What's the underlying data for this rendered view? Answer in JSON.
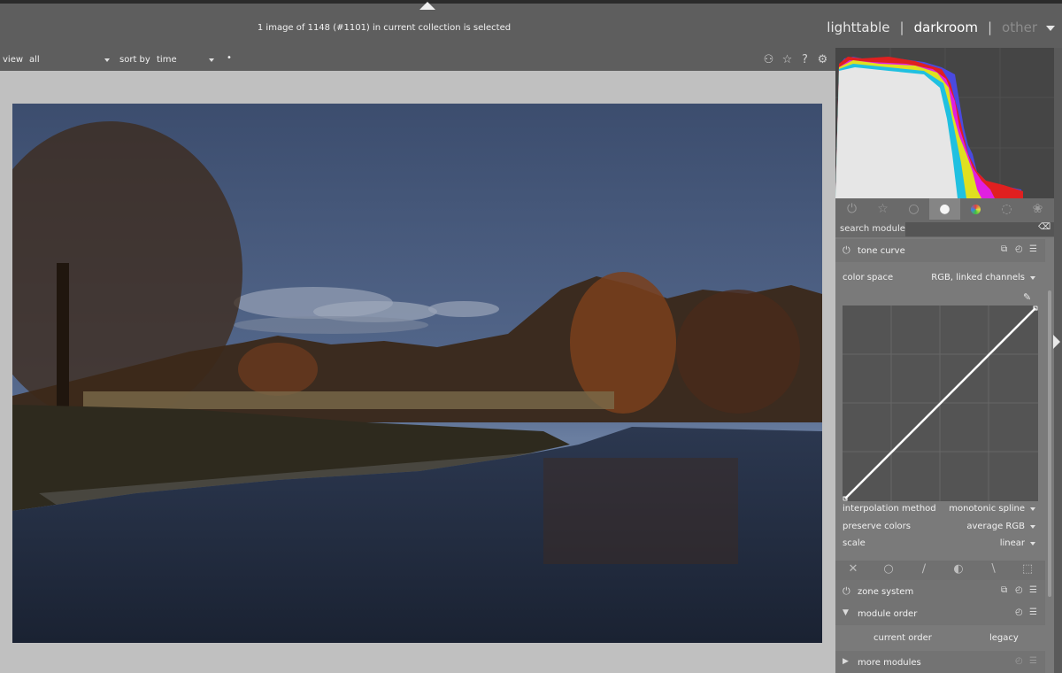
{
  "header": {
    "collection_info": "1 image of 1148 (#1101) in current collection is selected",
    "views": {
      "lighttable": "lighttable",
      "separator": "|",
      "darkroom": "darkroom",
      "other": "other"
    }
  },
  "filterbar": {
    "view_label": "view",
    "view_value": "all",
    "sort_label": "sort by",
    "sort_value": "time",
    "sort_dir": "•",
    "icons": [
      "color-labels-icon",
      "star-icon",
      "help-icon",
      "gear-icon"
    ]
  },
  "module_groups": {
    "icons": [
      "power-icon",
      "star-icon",
      "circle-icon",
      "tone-icon",
      "color-icon",
      "correct-icon",
      "effect-icon"
    ],
    "active_index": 3
  },
  "search": {
    "label": "search module",
    "value": ""
  },
  "tone_curve": {
    "name": "tone curve",
    "color_space_label": "color space",
    "color_space_value": "RGB, linked channels",
    "interpolation_label": "interpolation method",
    "interpolation_value": "monotonic spline",
    "preserve_label": "preserve colors",
    "preserve_value": "average RGB",
    "scale_label": "scale",
    "scale_value": "linear"
  },
  "zone_system": {
    "name": "zone system"
  },
  "module_order": {
    "name": "module order",
    "current": "current order",
    "legacy": "legacy"
  },
  "more_modules": {
    "name": "more modules"
  },
  "colors": {
    "accent_panel": "#7a7a7a",
    "curve_line": "#ffffff",
    "center_bg": "#c0c0c0"
  }
}
